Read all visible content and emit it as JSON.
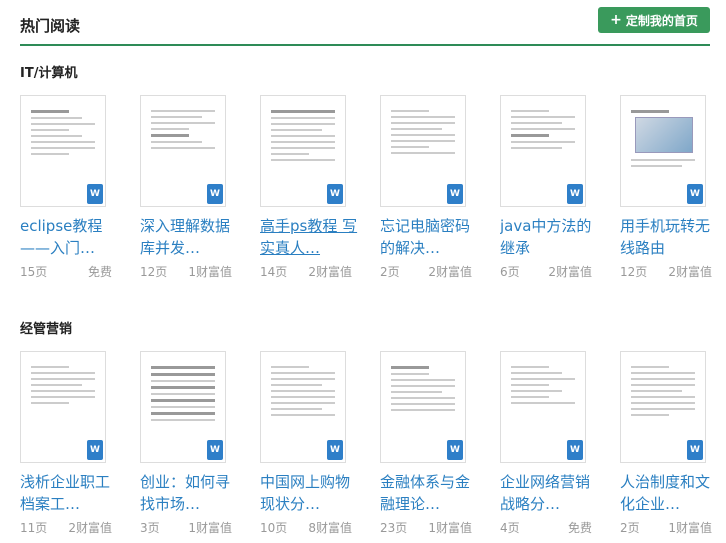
{
  "header": {
    "title": "热门阅读",
    "button_label": "定制我的首页"
  },
  "sections": [
    {
      "title": "IT/计算机",
      "items": [
        {
          "title": "eclipse教程——入门…",
          "pages": "15页",
          "price": "免费"
        },
        {
          "title": "深入理解数据库并发…",
          "pages": "12页",
          "price": "1财富值"
        },
        {
          "title": "高手ps教程 写实真人…",
          "pages": "14页",
          "price": "2财富值"
        },
        {
          "title": "忘记电脑密码的解决…",
          "pages": "2页",
          "price": "2财富值"
        },
        {
          "title": "java中方法的继承",
          "pages": "6页",
          "price": "2财富值"
        },
        {
          "title": "用手机玩转无线路由",
          "pages": "12页",
          "price": "2财富值"
        }
      ]
    },
    {
      "title": "经管营销",
      "items": [
        {
          "title": "浅析企业职工档案工…",
          "pages": "11页",
          "price": "2财富值"
        },
        {
          "title": "创业：如何寻找市场…",
          "pages": "3页",
          "price": "1财富值"
        },
        {
          "title": "中国网上购物现状分…",
          "pages": "10页",
          "price": "8财富值"
        },
        {
          "title": "金融体系与金融理论…",
          "pages": "23页",
          "price": "1财富值"
        },
        {
          "title": "企业网络营销战略分…",
          "pages": "4页",
          "price": "免费"
        },
        {
          "title": "人治制度和文化企业…",
          "pages": "2页",
          "price": "1财富值"
        }
      ]
    }
  ],
  "doc_icon": "word-doc-icon",
  "colors": {
    "accent": "#2e8b57",
    "link": "#2a7fc1",
    "button": "#3a9a5c"
  }
}
